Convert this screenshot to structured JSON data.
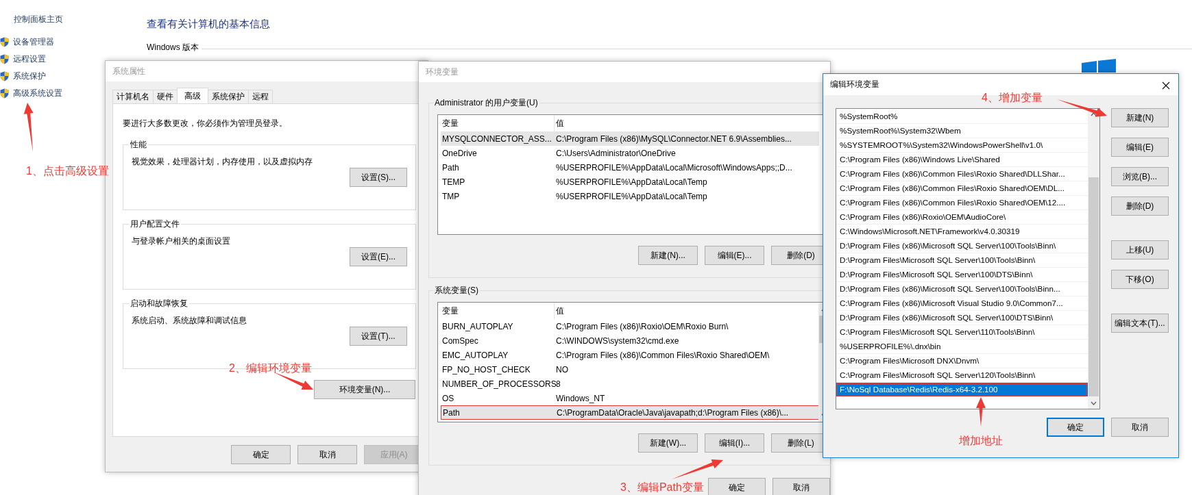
{
  "control_panel": {
    "home_link": "控制面板主页",
    "links": [
      "设备管理器",
      "远程设置",
      "系统保护",
      "高级系统设置"
    ],
    "heading": "查看有关计算机的基本信息",
    "section_title": "Windows 版本"
  },
  "system_properties": {
    "title": "系统属性",
    "tabs": [
      {
        "label": "计算机名",
        "selected": false
      },
      {
        "label": "硬件",
        "selected": false
      },
      {
        "label": "高级",
        "selected": true
      },
      {
        "label": "系统保护",
        "selected": false
      },
      {
        "label": "远程",
        "selected": false
      }
    ],
    "notice": "要进行大多数更改，你必须作为管理员登录。",
    "groups": [
      {
        "title": "性能",
        "description": "视觉效果，处理器计划，内存使用，以及虚拟内存",
        "button": "设置(S)..."
      },
      {
        "title": "用户配置文件",
        "description": "与登录帐户相关的桌面设置",
        "button": "设置(E)..."
      },
      {
        "title": "启动和故障恢复",
        "description": "系统启动、系统故障和调试信息",
        "button": "设置(T)..."
      }
    ],
    "env_button": "环境变量(N)...",
    "buttons": [
      {
        "label": "确定",
        "disabled": false
      },
      {
        "label": "取消",
        "disabled": false
      },
      {
        "label": "应用(A)",
        "disabled": true
      }
    ]
  },
  "environment_variables": {
    "title": "环境变量",
    "user_group": {
      "title": "Administrator 的用户变量(U)",
      "columns": [
        "变量",
        "值"
      ],
      "rows": [
        {
          "name": "MYSQLCONNECTOR_ASS...",
          "value": "C:\\Program Files (x86)\\MySQL\\Connector.NET 6.9\\Assemblies...",
          "selected": true,
          "marked": false
        },
        {
          "name": "OneDrive",
          "value": "C:\\Users\\Administrator\\OneDrive",
          "selected": false,
          "marked": false
        },
        {
          "name": "Path",
          "value": "%USERPROFILE%\\AppData\\Local\\Microsoft\\WindowsApps;;D...",
          "selected": false,
          "marked": false
        },
        {
          "name": "TEMP",
          "value": "%USERPROFILE%\\AppData\\Local\\Temp",
          "selected": false,
          "marked": false
        },
        {
          "name": "TMP",
          "value": "%USERPROFILE%\\AppData\\Local\\Temp",
          "selected": false,
          "marked": false
        }
      ],
      "buttons": [
        "新建(N)...",
        "编辑(E)...",
        "删除(D)"
      ]
    },
    "system_group": {
      "title": "系统变量(S)",
      "columns": [
        "变量",
        "值"
      ],
      "rows": [
        {
          "name": "BURN_AUTOPLAY",
          "value": "C:\\Program Files (x86)\\Roxio\\OEM\\Roxio Burn\\",
          "selected": false,
          "marked": false
        },
        {
          "name": "ComSpec",
          "value": "C:\\WINDOWS\\system32\\cmd.exe",
          "selected": false,
          "marked": false
        },
        {
          "name": "EMC_AUTOPLAY",
          "value": "C:\\Program Files (x86)\\Common Files\\Roxio Shared\\OEM\\",
          "selected": false,
          "marked": false
        },
        {
          "name": "FP_NO_HOST_CHECK",
          "value": "NO",
          "selected": false,
          "marked": false
        },
        {
          "name": "NUMBER_OF_PROCESSORS",
          "value": "8",
          "selected": false,
          "marked": false
        },
        {
          "name": "OS",
          "value": "Windows_NT",
          "selected": false,
          "marked": false
        },
        {
          "name": "Path",
          "value": "C:\\ProgramData\\Oracle\\Java\\javapath;d:\\Program Files (x86)\\...",
          "selected": true,
          "marked": true
        }
      ],
      "buttons": [
        "新建(W)...",
        "编辑(I)...",
        "删除(L)"
      ]
    },
    "buttons": [
      "确定",
      "取消"
    ]
  },
  "edit_variable": {
    "title": "编辑环境变量",
    "entries": [
      {
        "text": "%SystemRoot%",
        "selected": false,
        "marked": false
      },
      {
        "text": "%SystemRoot%\\System32\\Wbem",
        "selected": false,
        "marked": false
      },
      {
        "text": "%SYSTEMROOT%\\System32\\WindowsPowerShell\\v1.0\\",
        "selected": false,
        "marked": false
      },
      {
        "text": "C:\\Program Files (x86)\\Windows Live\\Shared",
        "selected": false,
        "marked": false
      },
      {
        "text": "C:\\Program Files (x86)\\Common Files\\Roxio Shared\\DLLShar...",
        "selected": false,
        "marked": false
      },
      {
        "text": "C:\\Program Files (x86)\\Common Files\\Roxio Shared\\OEM\\DL...",
        "selected": false,
        "marked": false
      },
      {
        "text": "C:\\Program Files (x86)\\Common Files\\Roxio Shared\\OEM\\12....",
        "selected": false,
        "marked": false
      },
      {
        "text": "C:\\Program Files (x86)\\Roxio\\OEM\\AudioCore\\",
        "selected": false,
        "marked": false
      },
      {
        "text": "C:\\Windows\\Microsoft.NET\\Framework\\v4.0.30319",
        "selected": false,
        "marked": false
      },
      {
        "text": "D:\\Program Files (x86)\\Microsoft SQL Server\\100\\Tools\\Binn\\",
        "selected": false,
        "marked": false
      },
      {
        "text": "D:\\Program Files\\Microsoft SQL Server\\100\\Tools\\Binn\\",
        "selected": false,
        "marked": false
      },
      {
        "text": "D:\\Program Files\\Microsoft SQL Server\\100\\DTS\\Binn\\",
        "selected": false,
        "marked": false
      },
      {
        "text": "D:\\Program Files (x86)\\Microsoft SQL Server\\100\\Tools\\Binn...",
        "selected": false,
        "marked": false
      },
      {
        "text": "C:\\Program Files (x86)\\Microsoft Visual Studio 9.0\\Common7...",
        "selected": false,
        "marked": false
      },
      {
        "text": "D:\\Program Files (x86)\\Microsoft SQL Server\\100\\DTS\\Binn\\",
        "selected": false,
        "marked": false
      },
      {
        "text": "C:\\Program Files\\Microsoft SQL Server\\110\\Tools\\Binn\\",
        "selected": false,
        "marked": false
      },
      {
        "text": "%USERPROFILE%\\.dnx\\bin",
        "selected": false,
        "marked": false
      },
      {
        "text": "C:\\Program Files\\Microsoft DNX\\Dnvm\\",
        "selected": false,
        "marked": false
      },
      {
        "text": "C:\\Program Files\\Microsoft SQL Server\\120\\Tools\\Binn\\",
        "selected": false,
        "marked": false
      },
      {
        "text": "F:\\NoSql Database\\Redis\\Redis-x64-3.2.100",
        "selected": true,
        "marked": true
      }
    ],
    "side_buttons": [
      [
        "新建(N)",
        "编辑(E)",
        "浏览(B)...",
        "删除(D)"
      ],
      [
        "上移(U)",
        "下移(O)"
      ],
      [
        "编辑文本(T)..."
      ]
    ],
    "buttons": [
      {
        "label": "确定",
        "default": true
      },
      {
        "label": "取消",
        "default": false
      }
    ]
  },
  "annotations": [
    "1、点击高级设置",
    "2、编辑环境变量",
    "3、编辑Path变量",
    "4、增加变量",
    "增加地址"
  ]
}
